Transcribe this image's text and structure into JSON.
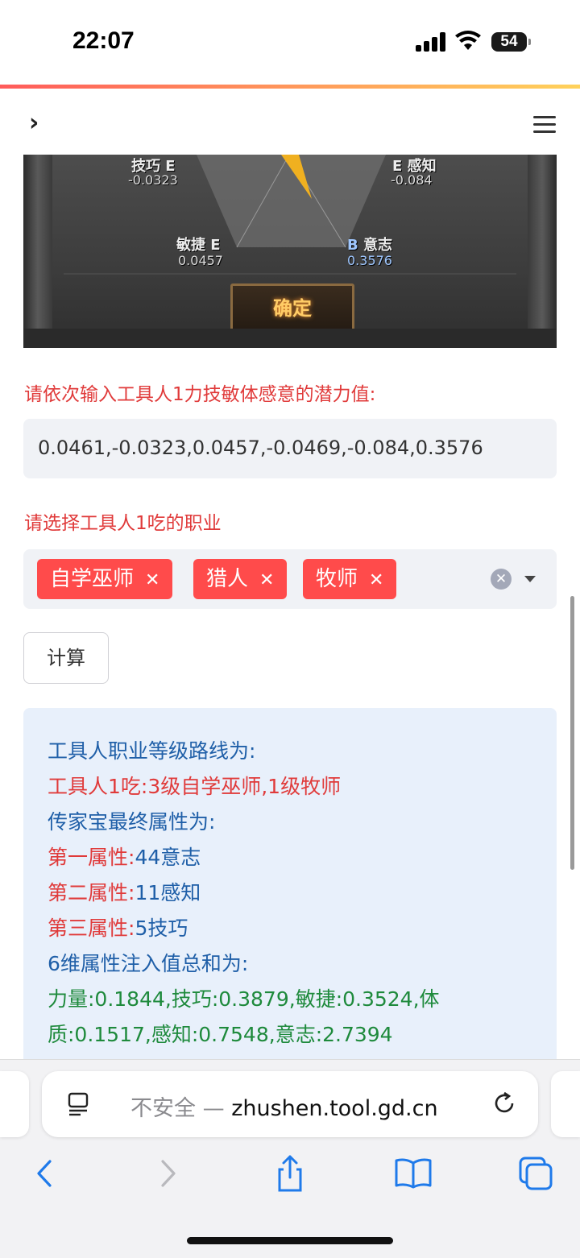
{
  "status_bar": {
    "time": "22:07",
    "battery": "54"
  },
  "nav": {
    "back_icon": "chevron-right-icon",
    "menu_icon": "hamburger-menu-icon"
  },
  "game_image": {
    "attrs": [
      {
        "label": "技巧",
        "grade": "E",
        "value": "-0.0323"
      },
      {
        "label": "感知",
        "grade": "E",
        "value": "-0.084"
      },
      {
        "label": "敏捷",
        "grade": "E",
        "value": "0.0457"
      },
      {
        "label": "意志",
        "grade": "B",
        "value": "0.3576"
      }
    ],
    "confirm_label": "确定"
  },
  "form": {
    "potential_label": "请依次输入工具人1力技敏体感意的潜力值:",
    "potential_value": "0.0461,-0.0323,0.0457,-0.0469,-0.084,0.3576",
    "job_label": "请选择工具人1吃的职业",
    "selected_jobs": [
      "自学巫师",
      "猎人",
      "牧师"
    ],
    "calc_button": "计算"
  },
  "result": {
    "route_title": "工具人职业等级路线为:",
    "route_line": "工具人1吃:3级自学巫师,1级牧师",
    "heirloom_title": "传家宝最终属性为:",
    "attr1_label": "第一属性:",
    "attr1_value": "44意志",
    "attr2_label": "第二属性:",
    "attr2_value": "11感知",
    "attr3_label": "第三属性:",
    "attr3_value": "5技巧",
    "sum_title": "6维属性注入值总和为:",
    "sum_line1": "力量:0.1844,技巧:0.3879,敏捷:0.3524,体",
    "sum_line2": "质:0.1517,感知:0.7548,意志:2.7394"
  },
  "browser": {
    "not_secure": "不安全 —",
    "domain": "zhushen.tool.gd.cn"
  },
  "colors": {
    "accent_red": "#ff4b4b",
    "label_red": "#e03a3a",
    "result_bg": "#e8f0fb"
  }
}
